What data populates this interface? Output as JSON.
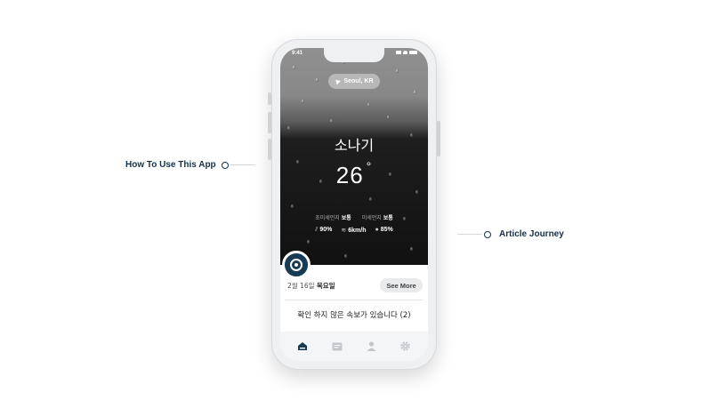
{
  "callouts": {
    "left_label": "How To Use This App",
    "right_label": "Article Journey"
  },
  "status_bar": {
    "time": "9:41"
  },
  "weather": {
    "location": "Seoul, KR",
    "condition": "소나기",
    "temperature": "26",
    "degree_symbol": "°",
    "ultrafine_dust_label": "초미세먼지",
    "ultrafine_dust_value": "보통",
    "fine_dust_label": "미세먼지",
    "fine_dust_value": "보통",
    "rain_chance": "90%",
    "wind_speed": "6km/h",
    "humidity": "85%"
  },
  "card": {
    "date": "2월 16일",
    "weekday": "목요일",
    "see_more_label": "See More",
    "alert_text": "확인 하지 않은 속보가 있습니다 (2)"
  },
  "tabbar": {
    "items": [
      {
        "icon": "home-icon",
        "active": true
      },
      {
        "icon": "news-icon",
        "active": false
      },
      {
        "icon": "profile-icon",
        "active": false
      },
      {
        "icon": "settings-icon",
        "active": false
      }
    ]
  },
  "colors": {
    "accent": "#173a55",
    "label": "#13314d",
    "tab_inactive": "#c3c7cc"
  }
}
